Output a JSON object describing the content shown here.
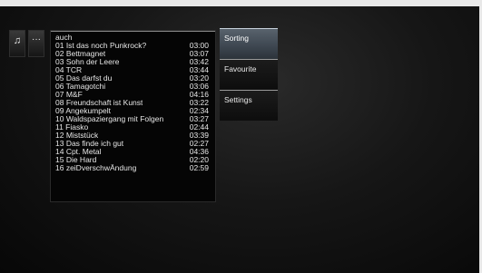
{
  "side_icons": [
    {
      "icon": "music-note-icon",
      "glyph": "♫"
    },
    {
      "icon": "more-icon",
      "glyph": "···"
    }
  ],
  "playlist": {
    "title": "auch",
    "tracks": [
      {
        "title": "01 Ist das noch Punkrock?",
        "duration": "03:00"
      },
      {
        "title": "02 Bettmagnet",
        "duration": "03:07"
      },
      {
        "title": "03 Sohn der Leere",
        "duration": "03:42"
      },
      {
        "title": "04 TCR",
        "duration": "03:44"
      },
      {
        "title": "05 Das darfst du",
        "duration": "03:20"
      },
      {
        "title": "06 Tamagotchi",
        "duration": "03:06"
      },
      {
        "title": "07 M&F",
        "duration": "04:16"
      },
      {
        "title": "08 Freundschaft ist Kunst",
        "duration": "03:22"
      },
      {
        "title": "09 Angekumpelt",
        "duration": "02:34"
      },
      {
        "title": "10 Waldspaziergang mit Folgen",
        "duration": "03:27"
      },
      {
        "title": "11 Fiasko",
        "duration": "02:44"
      },
      {
        "title": "12 Miststück",
        "duration": "03:39"
      },
      {
        "title": "13 Das finde ich gut",
        "duration": "02:27"
      },
      {
        "title": "14 Cpt. Metal",
        "duration": "04:36"
      },
      {
        "title": "15 Die Hard",
        "duration": "02:20"
      },
      {
        "title": "16 zeiDverschwÄndung",
        "duration": "02:59"
      }
    ]
  },
  "menu": {
    "items": [
      {
        "label": "Sorting",
        "selected": true
      },
      {
        "label": "Favourite",
        "selected": false
      },
      {
        "label": "Settings",
        "selected": false
      }
    ]
  }
}
